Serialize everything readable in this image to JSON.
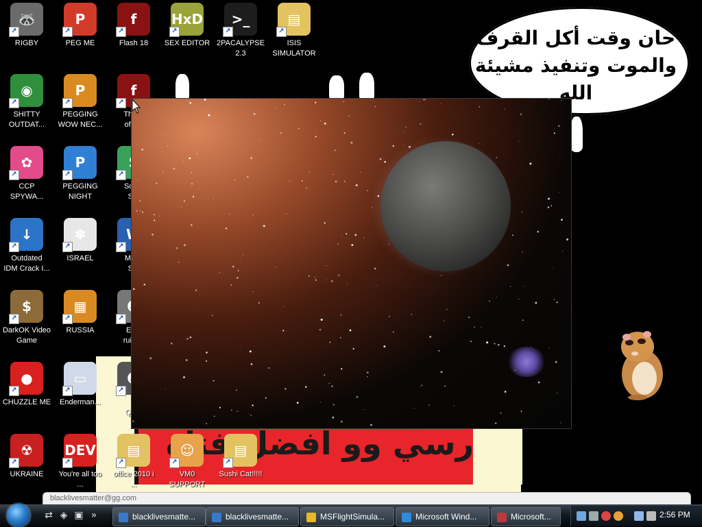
{
  "desktop_icons": [
    {
      "name": "icon-rigby",
      "label": "RIGBY",
      "color": "#6b6b6b",
      "glyph": "🦝"
    },
    {
      "name": "icon-peg-me",
      "label": "PEG ME",
      "color": "#d23b2a",
      "glyph": "P"
    },
    {
      "name": "icon-flash-18",
      "label": "Flash 18",
      "color": "#8a1212",
      "glyph": "f"
    },
    {
      "name": "icon-sex-editor",
      "label": "SEX EDITOR",
      "color": "#9aa23a",
      "glyph": "HxD"
    },
    {
      "name": "icon-2pacalypse",
      "label": "2PACALYPSE\n2.3",
      "color": "#1d1d1d",
      "glyph": ">_"
    },
    {
      "name": "icon-isis-simulator",
      "label": "ISIS\nSIMULATOR",
      "color": "#e3c262",
      "glyph": "▤"
    },
    {
      "name": "icon-shitty-outdated",
      "label": "SHITTY\nOUTDAT...",
      "color": "#2f8f3d",
      "glyph": "◉"
    },
    {
      "name": "icon-pegging-wow",
      "label": "PEGGING\nWOW NEC...",
      "color": "#d98b21",
      "glyph": "P"
    },
    {
      "name": "icon-the-b",
      "label": "The B\nof Isa",
      "color": "#8a1212",
      "glyph": "f"
    },
    {
      "name": "icon-ccp-spyware",
      "label": "CCP\nSPYWA...",
      "color": "#e34b8a",
      "glyph": "✿"
    },
    {
      "name": "icon-pegging-night",
      "label": "PEGGING\nNIGHT",
      "color": "#2f7fd4",
      "glyph": "P"
    },
    {
      "name": "icon-script-stu",
      "label": "Script\nStu",
      "color": "#3aa15a",
      "glyph": "S"
    },
    {
      "name": "icon-outdated-idm",
      "label": "Outdated\nIDM Crack I...",
      "color": "#2b74c8",
      "glyph": "↓"
    },
    {
      "name": "icon-israel",
      "label": "ISRAEL",
      "color": "#e7e7e7",
      "glyph": "✽"
    },
    {
      "name": "icon-masc-stu",
      "label": "Masc\nStu",
      "color": "#2b5fb0",
      "glyph": "W"
    },
    {
      "name": "icon-darkok",
      "label": "DarkOK Video\nGame",
      "color": "#8d6a3a",
      "glyph": "$"
    },
    {
      "name": "icon-russia",
      "label": "RUSSIA",
      "color": "#d98b21",
      "glyph": "▦"
    },
    {
      "name": "icon-elon-ruined",
      "label": "Elon\nruined",
      "color": "#777",
      "glyph": "☻"
    },
    {
      "name": "icon-chuzzle-me",
      "label": "CHUZZLE ME",
      "color": "#d8201e",
      "glyph": "●"
    },
    {
      "name": "icon-enderman",
      "label": "Enderman...",
      "color": "#cfd9e8",
      "glyph": "▭"
    },
    {
      "name": "icon-quran",
      "label": "I\nQura",
      "color": "#555",
      "glyph": "☻"
    },
    {
      "name": "icon-ukraine",
      "label": "UKRAINE",
      "color": "#c8201e",
      "glyph": "☢"
    },
    {
      "name": "icon-dev-cpp",
      "label": "You're all too\n...",
      "color": "#d8201e",
      "glyph": "DEV"
    },
    {
      "name": "icon-office-2010",
      "label": "office 2010 i\n...",
      "color": "#e3c262",
      "glyph": "▤"
    },
    {
      "name": "icon-vm0-support",
      "label": "VM0\nSUPPORT",
      "color": "#e8a24a",
      "glyph": "☺"
    },
    {
      "name": "icon-sushi-cat",
      "label": "Sushi Cat!!!!!",
      "color": "#e3c262",
      "glyph": "▤"
    }
  ],
  "wallpaper": {
    "bubble_line1": "حان وقت أكل القرف",
    "bubble_line2": "والموت وتنفيذ مشيئة الله",
    "banner_text": "مارسي وو افضل فتاة"
  },
  "address_strip": "blacklivesmatter@gg.com",
  "taskbar": {
    "quick_launch": [
      "⇄",
      "◈",
      "▣",
      "»"
    ],
    "tasks": [
      {
        "label": "blacklivesmatte...",
        "color": "#3a78c8"
      },
      {
        "label": "blacklivesmatte...",
        "color": "#3a78c8"
      },
      {
        "label": "MSFlightSimula...",
        "color": "#e8b828"
      },
      {
        "label": "Microsoft Wind...",
        "color": "#2f8ad8"
      },
      {
        "label": "Microsoft...",
        "color": "#b83a3a"
      }
    ],
    "clock": "2:56 PM"
  },
  "space_window": {
    "nebula_color": "#8b7bd6"
  }
}
